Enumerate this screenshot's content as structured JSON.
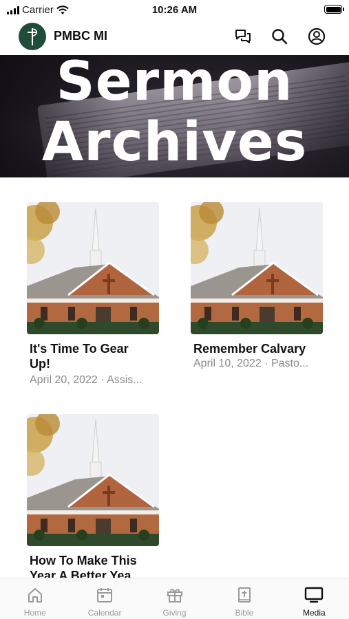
{
  "status_bar": {
    "carrier": "Carrier",
    "time": "10:26 AM"
  },
  "header": {
    "title": "PMBC MI",
    "icons": [
      "chat-icon",
      "search-icon",
      "account-icon"
    ]
  },
  "banner": {
    "line1": "Sermon",
    "line2": "Archives"
  },
  "sermons": [
    {
      "title": "It's Time To Gear Up!",
      "meta": "April 20, 2022 · Assis..."
    },
    {
      "title": "Remember Calvary",
      "meta": "April 10, 2022 · Pasto..."
    },
    {
      "title": "How To Make This Year A Better Yea..."
    }
  ],
  "tabs": [
    {
      "label": "Home",
      "icon": "home-icon"
    },
    {
      "label": "Calendar",
      "icon": "calendar-icon"
    },
    {
      "label": "Giving",
      "icon": "gift-icon"
    },
    {
      "label": "Bible",
      "icon": "bible-icon"
    },
    {
      "label": "Media",
      "icon": "tv-icon",
      "active": true
    }
  ],
  "colors": {
    "logo_bg": "#1f4d3a",
    "active_tab": "#111111",
    "inactive_tab": "#9a9a9a"
  }
}
